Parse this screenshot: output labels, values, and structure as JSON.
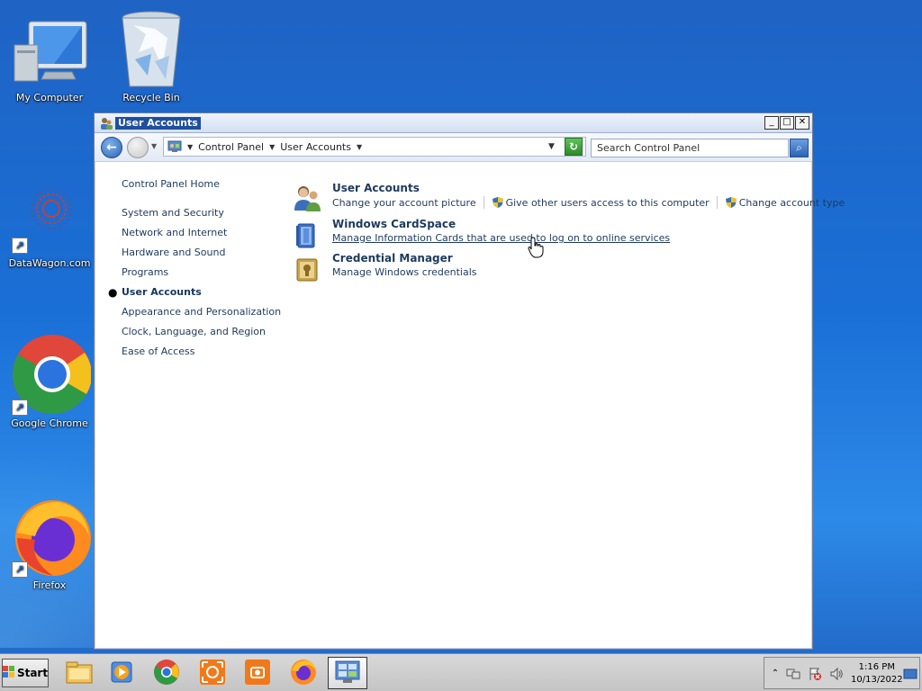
{
  "desktop": {
    "icons": [
      {
        "label": "My Computer",
        "icon": "computer-icon"
      },
      {
        "label": "Recycle Bin",
        "icon": "recycle-bin-icon"
      },
      {
        "label": "DataWagon.com",
        "icon": "datawagon-icon"
      },
      {
        "label": "Google Chrome",
        "icon": "chrome-icon"
      },
      {
        "label": "Firefox",
        "icon": "firefox-icon"
      }
    ]
  },
  "window": {
    "title": "User Accounts",
    "controls": {
      "minimize": "_",
      "maximize": "□",
      "close": "✕"
    },
    "address": {
      "crumbs": [
        "Control Panel",
        "User Accounts"
      ]
    },
    "search": {
      "placeholder": "Search Control Panel"
    },
    "sidebar": {
      "items": [
        {
          "label": "Control Panel Home"
        },
        {
          "label": "System and Security"
        },
        {
          "label": "Network and Internet"
        },
        {
          "label": "Hardware and Sound"
        },
        {
          "label": "Programs"
        },
        {
          "label": "User Accounts",
          "active": true
        },
        {
          "label": "Appearance and Personalization"
        },
        {
          "label": "Clock, Language, and Region"
        },
        {
          "label": "Ease of Access"
        }
      ]
    },
    "categories": [
      {
        "title": "User Accounts",
        "links": [
          "Change your account picture",
          "Give other users access to this computer",
          "Change account type"
        ]
      },
      {
        "title": "Windows CardSpace",
        "links": [
          "Manage Information Cards that are used to log on to online services"
        ]
      },
      {
        "title": "Credential Manager",
        "links": [
          "Manage Windows credentials"
        ]
      }
    ]
  },
  "taskbar": {
    "start_label": "Start",
    "apps": [
      "file-explorer-icon",
      "media-player-icon",
      "chrome-icon",
      "screen-recorder-icon",
      "screenshot-icon",
      "firefox-icon",
      "control-panel-icon"
    ],
    "clock": {
      "time": "1:16 PM",
      "date": "10/13/2022"
    }
  },
  "colors": {
    "link": "#1e3a5c",
    "accent": "#1f4f9e",
    "desktop": "#1a6fd6"
  }
}
